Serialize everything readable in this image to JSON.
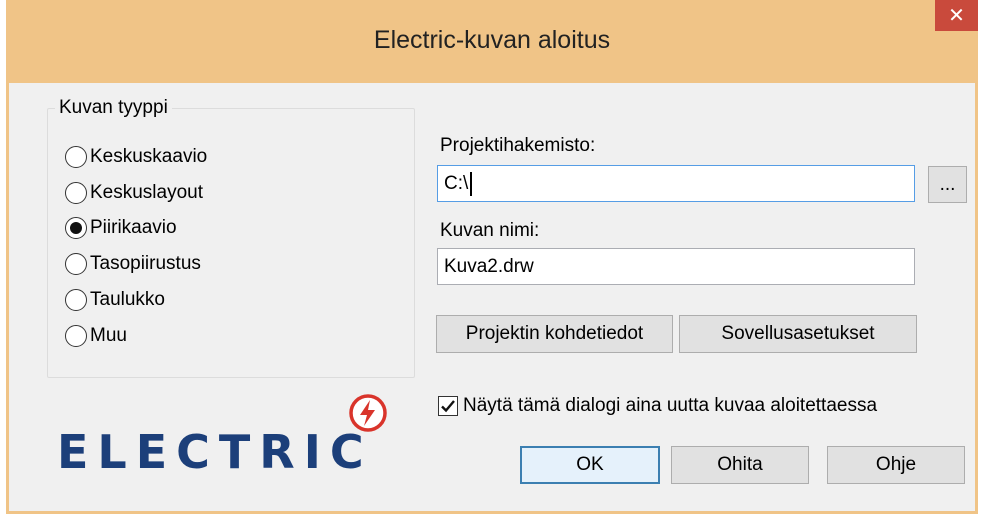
{
  "window": {
    "title": "Electric-kuvan aloitus",
    "close_glyph": "✕"
  },
  "group": {
    "title": "Kuvan tyyppi",
    "options": [
      {
        "label": "Keskuskaavio",
        "selected": false
      },
      {
        "label": "Keskuslayout",
        "selected": false
      },
      {
        "label": "Piirikaavio",
        "selected": true
      },
      {
        "label": "Tasopiirustus",
        "selected": false
      },
      {
        "label": "Taulukko",
        "selected": false
      },
      {
        "label": "Muu",
        "selected": false
      }
    ]
  },
  "project": {
    "label": "Projektihakemisto:",
    "value": "C:\\",
    "browse_label": "..."
  },
  "image": {
    "label": "Kuvan nimi:",
    "value": "Kuva2.drw"
  },
  "buttons": {
    "project_targets": "Projektin kohdetiedot",
    "app_settings": "Sovellusasetukset",
    "ok": "OK",
    "skip": "Ohita",
    "help": "Ohje"
  },
  "checkbox": {
    "label": "Näytä tämä dialogi aina uutta kuvaa aloitettaessa",
    "checked": true
  },
  "logo": {
    "text": "ELECTRIC",
    "icon": "lightning-bolt-icon"
  },
  "colors": {
    "titlebar": "#f0c487",
    "close": "#c94a3c",
    "client": "#f0f0f0",
    "logo": "#1c3f7a",
    "logo_accent": "#d9342b"
  }
}
